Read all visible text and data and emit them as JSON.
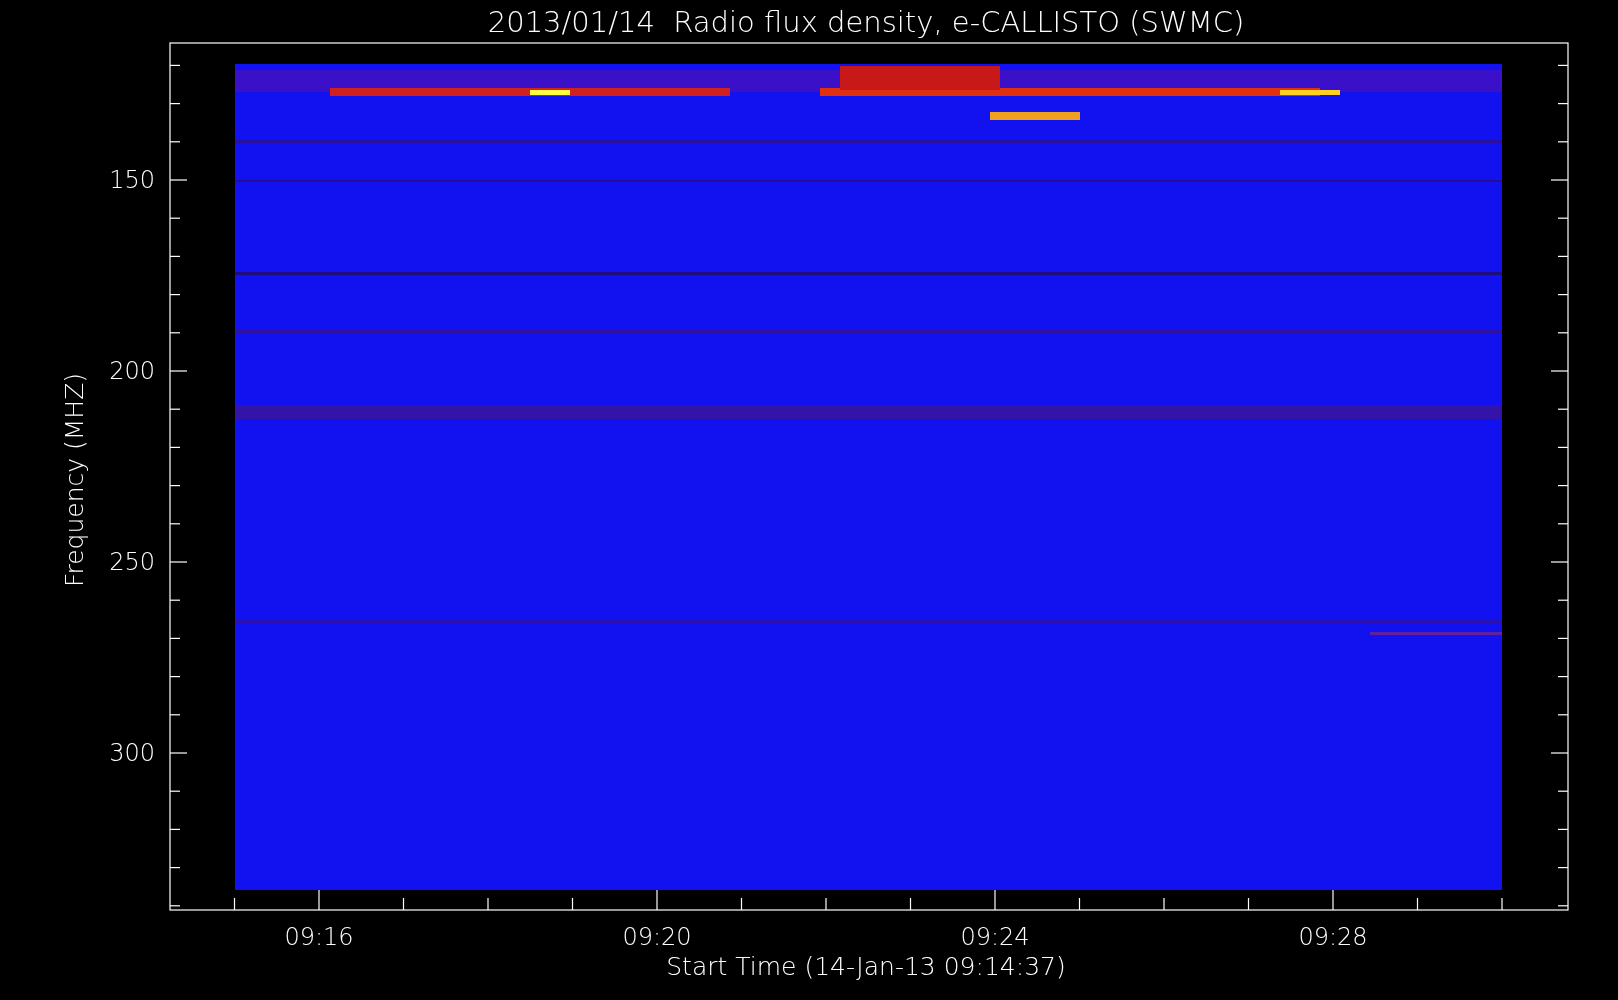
{
  "title": "2013/01/14  Radio flux density, e-CALLISTO (SWMC)",
  "y_axis": {
    "label": "Frequency (MHZ)",
    "ticks": [
      "150",
      "200",
      "250",
      "300"
    ]
  },
  "x_axis": {
    "label": "Start Time (14-Jan-13 09:14:37)",
    "ticks": [
      "09:16",
      "09:20",
      "09:24",
      "09:28"
    ]
  }
}
